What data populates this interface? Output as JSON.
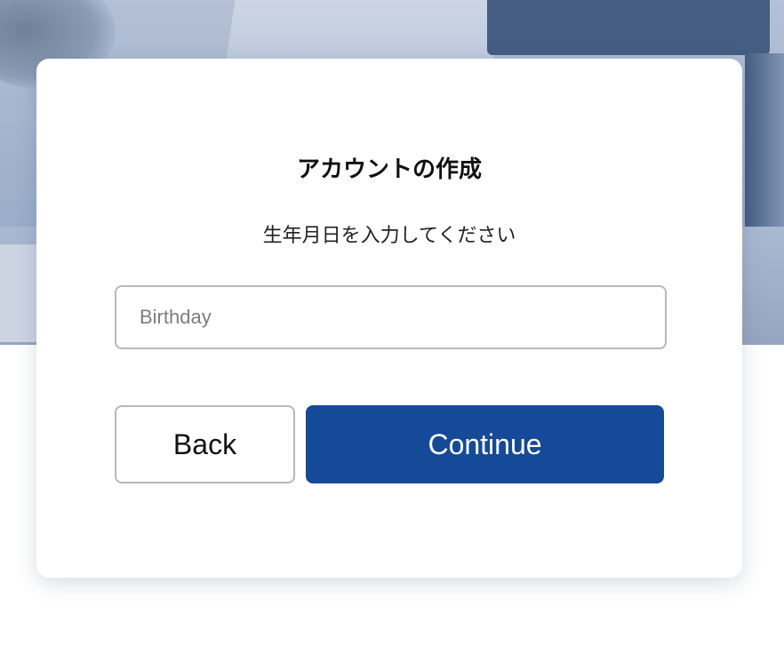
{
  "card": {
    "title": "アカウントの作成",
    "subtitle": "生年月日を入力してください"
  },
  "form": {
    "birthday": {
      "value": "",
      "placeholder": "Birthday"
    }
  },
  "actions": {
    "back_label": "Back",
    "continue_label": "Continue"
  },
  "colors": {
    "primary": "#154a99",
    "border": "#b5b9c0",
    "card_background": "#ffffff"
  },
  "icons": {
    "background": "blurred-desk-photo"
  }
}
